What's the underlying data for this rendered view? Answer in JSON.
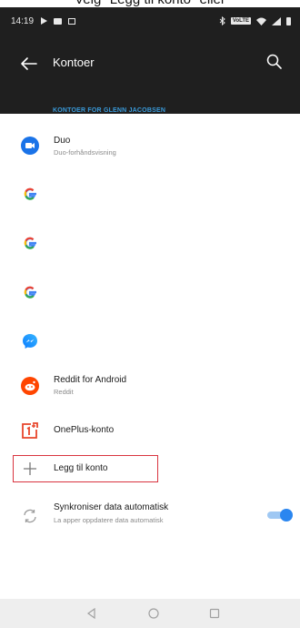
{
  "caption": "Velg \"Legg til konto\" eller",
  "status_bar": {
    "time": "14:19",
    "network_badge": "VoLTE"
  },
  "app_bar": {
    "title": "Kontoer"
  },
  "section_header": "KONTOER FOR GLENN JACOBSEN",
  "accounts": [
    {
      "title": "Duo",
      "subtitle": "Duo-forhåndsvisning",
      "icon": "duo-icon"
    },
    {
      "title": "",
      "subtitle": "",
      "icon": "google-icon"
    },
    {
      "title": "",
      "subtitle": "",
      "icon": "google-icon"
    },
    {
      "title": "",
      "subtitle": "",
      "icon": "google-icon"
    },
    {
      "title": "",
      "subtitle": "",
      "icon": "messenger-icon"
    },
    {
      "title": "Reddit for Android",
      "subtitle": "Reddit",
      "icon": "reddit-icon"
    },
    {
      "title": "OnePlus-konto",
      "subtitle": "",
      "icon": "oneplus-icon"
    }
  ],
  "add_account": {
    "label": "Legg til konto"
  },
  "sync": {
    "title": "Synkroniser data automatisk",
    "subtitle": "La apper oppdatere data automatisk",
    "enabled": true
  },
  "colors": {
    "accent": "#2a86f0",
    "header_bg": "#1f1f1f",
    "section_header": "#3a9ad9",
    "highlight_border": "#d9343f"
  }
}
